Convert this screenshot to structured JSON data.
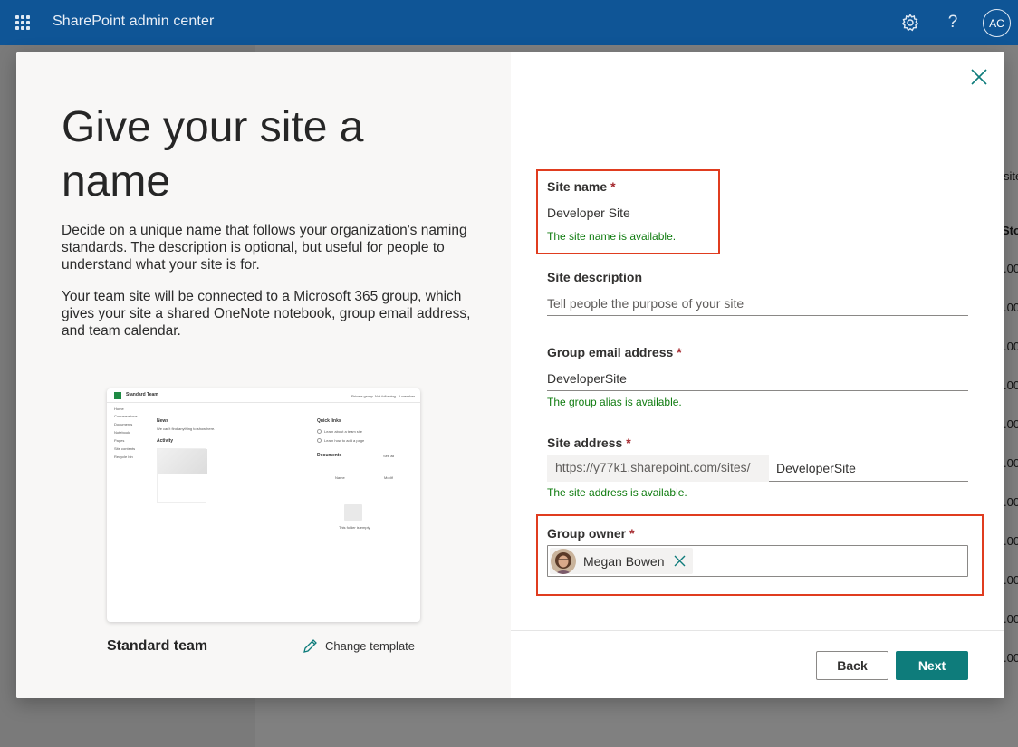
{
  "app": {
    "title": "SharePoint admin center",
    "user_initials": "AC"
  },
  "icons": {
    "launcher": "waffle-icon",
    "settings": "gear-icon",
    "help": "question-icon",
    "close": "close-icon",
    "edit": "pencil-icon",
    "remove": "close-icon"
  },
  "colors": {
    "topbar": "#0f5596",
    "accent": "#0e7c7b",
    "success": "#107c10",
    "required": "#a4262c",
    "highlight": "#e03c1f"
  },
  "background": {
    "fragment_header": "site",
    "fragment_col": "Sto",
    "fragment_cells": [
      ".00",
      ".00",
      ".00",
      ".00",
      ".00",
      ".00",
      ".00",
      ".00",
      ".00",
      ".00",
      ".00",
      ".00"
    ]
  },
  "left": {
    "title": "Give your site a name",
    "desc1": "Decide on a unique name that follows your organization's naming standards. The description is optional, but useful for people to understand what your site is for.",
    "desc2": "Your team site will be connected to a Microsoft 365 group, which gives your site a shared OneNote notebook, group email address, and team calendar.",
    "template_name": "Standard team",
    "change_template": "Change template",
    "preview": {
      "site_title": "Standard Team",
      "nav": [
        "Home",
        "Conversations",
        "Documents",
        "Notebook",
        "Pages",
        "Site contents",
        "Recycle bin"
      ],
      "news": "News",
      "news_sub": "We can't find anything to show here.",
      "activity": "Activity",
      "quick_links": "Quick links",
      "quick_link_1": "Learn about a team site",
      "quick_link_2": "Learn how to add a page",
      "documents": "Documents",
      "see_all": "See all",
      "doc_col_name": "Name",
      "doc_col_modified": "Modif",
      "empty": "This folder is empty",
      "top_right_1": "Private group",
      "top_right_2": "Not following",
      "top_right_3": "1 member"
    }
  },
  "form": {
    "site_name": {
      "label": "Site name",
      "value": "Developer Site",
      "helper": "The site name is available."
    },
    "site_description": {
      "label": "Site description",
      "placeholder": "Tell people the purpose of your site"
    },
    "group_email": {
      "label": "Group email address",
      "value": "DeveloperSite",
      "helper": "The group alias is available."
    },
    "site_address": {
      "label": "Site address",
      "prefix": "https://y77k1.sharepoint.com/sites/",
      "value": "DeveloperSite",
      "helper": "The site address is available."
    },
    "group_owner": {
      "label": "Group owner",
      "owner_name": "Megan Bowen"
    },
    "required_marker": "*"
  },
  "buttons": {
    "back": "Back",
    "next": "Next"
  }
}
